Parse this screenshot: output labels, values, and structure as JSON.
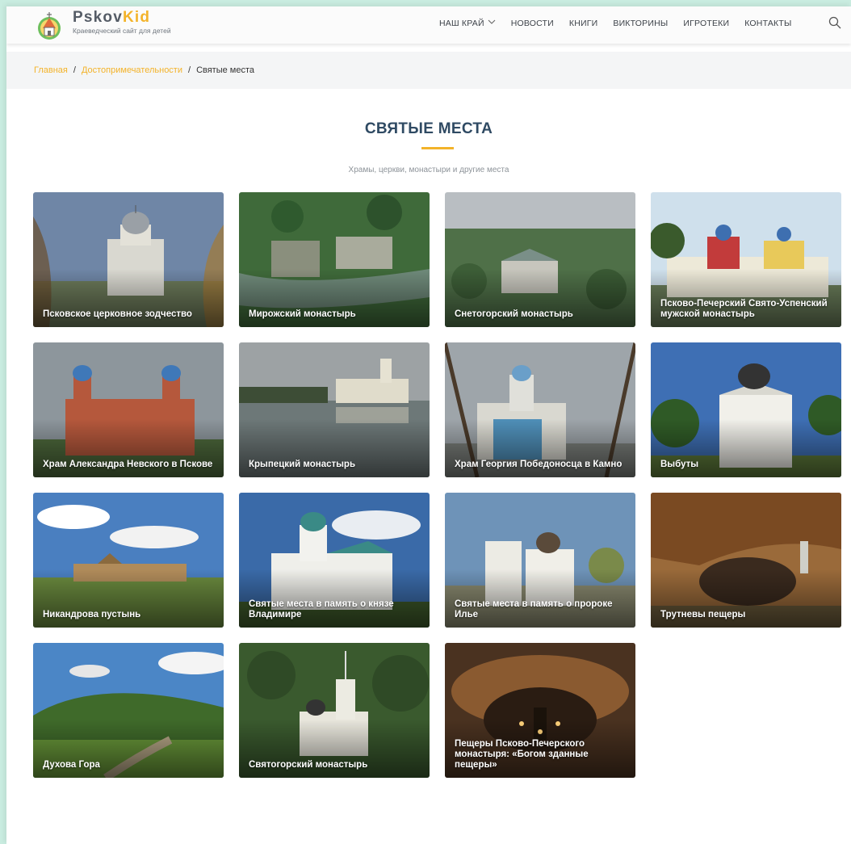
{
  "brand": {
    "name_a": "Pskov",
    "name_b": "Kid",
    "tagline": "Краеведческий сайт для детей"
  },
  "nav": [
    {
      "label": "НАШ КРАЙ",
      "has_dropdown": true
    },
    {
      "label": "НОВОСТИ"
    },
    {
      "label": "КНИГИ"
    },
    {
      "label": "ВИКТОРИНЫ"
    },
    {
      "label": "ИГРОТЕКИ"
    },
    {
      "label": "КОНТАКТЫ"
    }
  ],
  "breadcrumb": {
    "home": "Главная",
    "section": "Достопримечательности",
    "current": "Святые места",
    "sep": "/"
  },
  "page": {
    "title": "СВЯТЫЕ МЕСТА",
    "subtitle": "Храмы, церкви, монастыри и другие места"
  },
  "cards": [
    {
      "title": "Псковское церковное зодчество",
      "scene": "church-trees"
    },
    {
      "title": "Мирожский монастырь",
      "scene": "aerial-river"
    },
    {
      "title": "Снетогорский монастырь",
      "scene": "aerial-town"
    },
    {
      "title": "Псково-Печерский Свято-Успенский мужской монастырь",
      "scene": "monastery-colorful"
    },
    {
      "title": "Храм Александра Невского в Пскове",
      "scene": "red-church"
    },
    {
      "title": "Крыпецкий монастырь",
      "scene": "lake-reflection"
    },
    {
      "title": "Храм Георгия Победоносца в Камно",
      "scene": "blue-gate"
    },
    {
      "title": "Выбуты",
      "scene": "white-church"
    },
    {
      "title": "Никандрова пустынь",
      "scene": "field-clouds"
    },
    {
      "title": "Святые места в память о князе Владимире",
      "scene": "church-sky"
    },
    {
      "title": "Святые места в память о пророке Илье",
      "scene": "belfry-church"
    },
    {
      "title": "Трутневы пещеры",
      "scene": "cave-rock"
    },
    {
      "title": "Духова Гора",
      "scene": "green-hill"
    },
    {
      "title": "Святогорский монастырь",
      "scene": "aerial-forest"
    },
    {
      "title": "Пещеры Псково-Печерского монастыря: «Богом зданные пещеры»",
      "scene": "cave-interior"
    }
  ]
}
